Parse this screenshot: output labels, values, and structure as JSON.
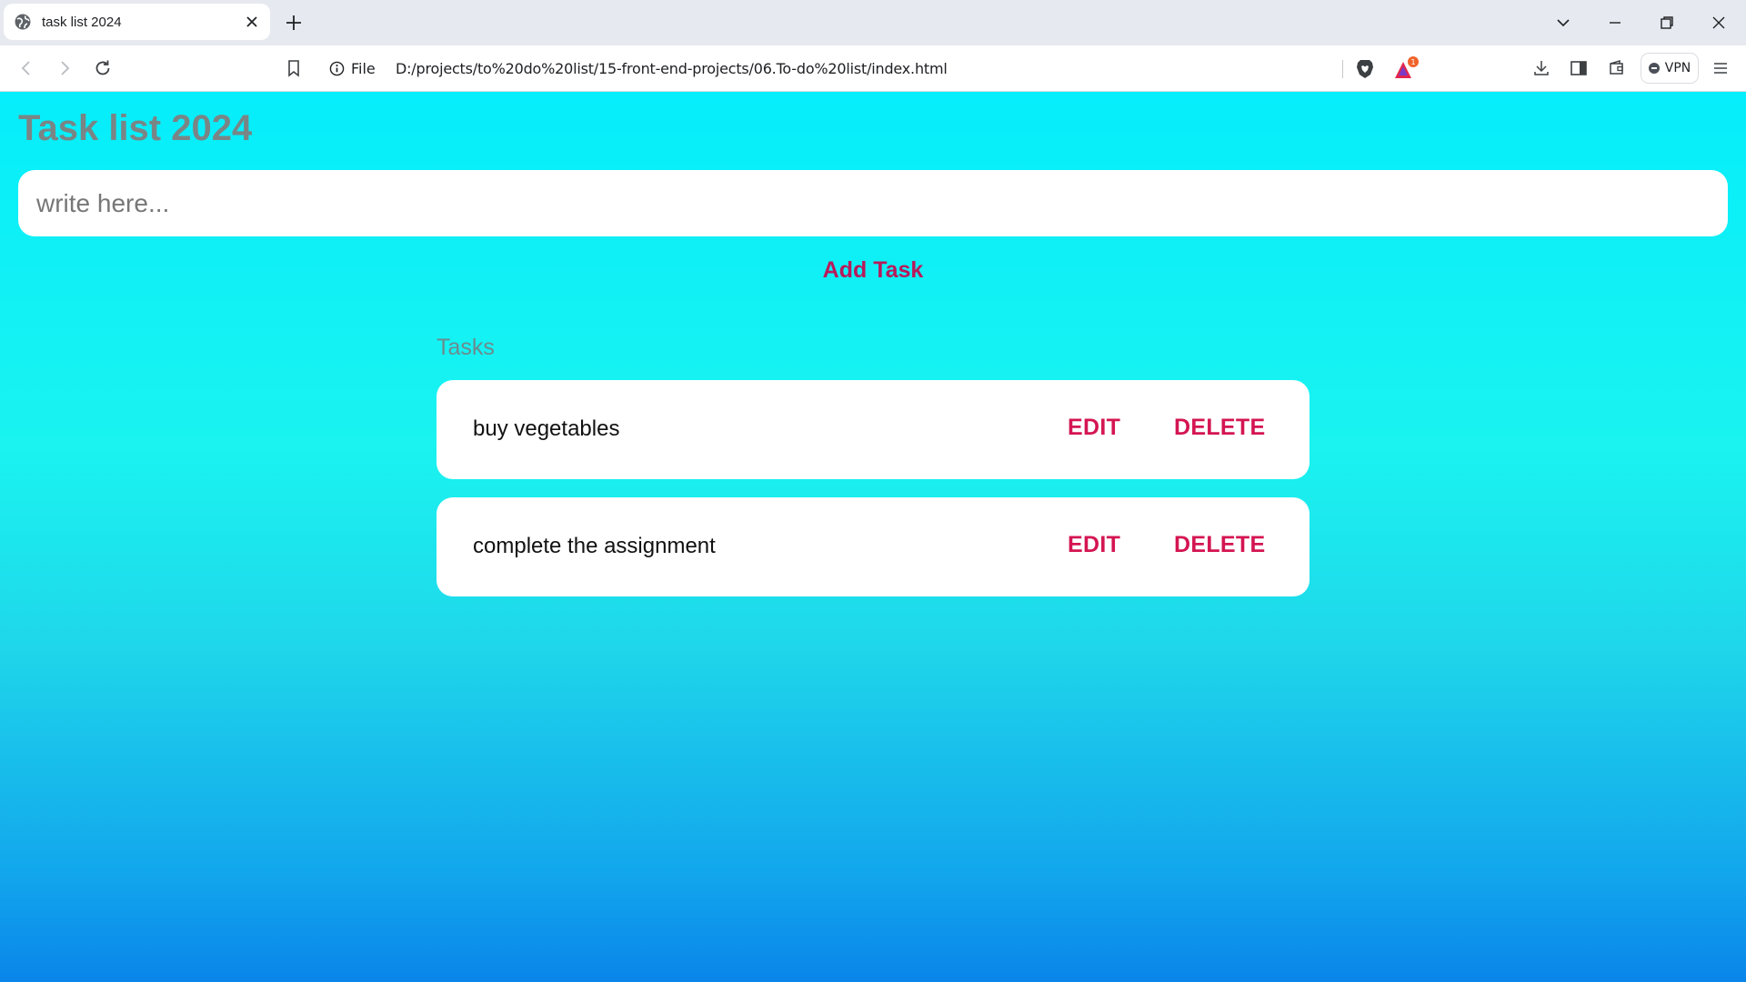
{
  "browser": {
    "tab_title": "task list 2024",
    "url_scheme": "File",
    "url": "D:/projects/to%20do%20list/15-front-end-projects/06.To-do%20list/index.html",
    "rewards_badge": "1",
    "vpn_label": "VPN"
  },
  "app": {
    "title": "Task list 2024",
    "input_placeholder": "write here...",
    "add_button": "Add Task",
    "tasks_heading": "Tasks",
    "tasks": [
      {
        "text": "buy vegetables",
        "edit_label": "EDIT",
        "delete_label": "DELETE"
      },
      {
        "text": "complete the assignment",
        "edit_label": "EDIT",
        "delete_label": "DELETE"
      }
    ]
  },
  "colors": {
    "accent": "#d41552",
    "background_top": "#05eefb",
    "background_bottom": "#0a85ea"
  }
}
